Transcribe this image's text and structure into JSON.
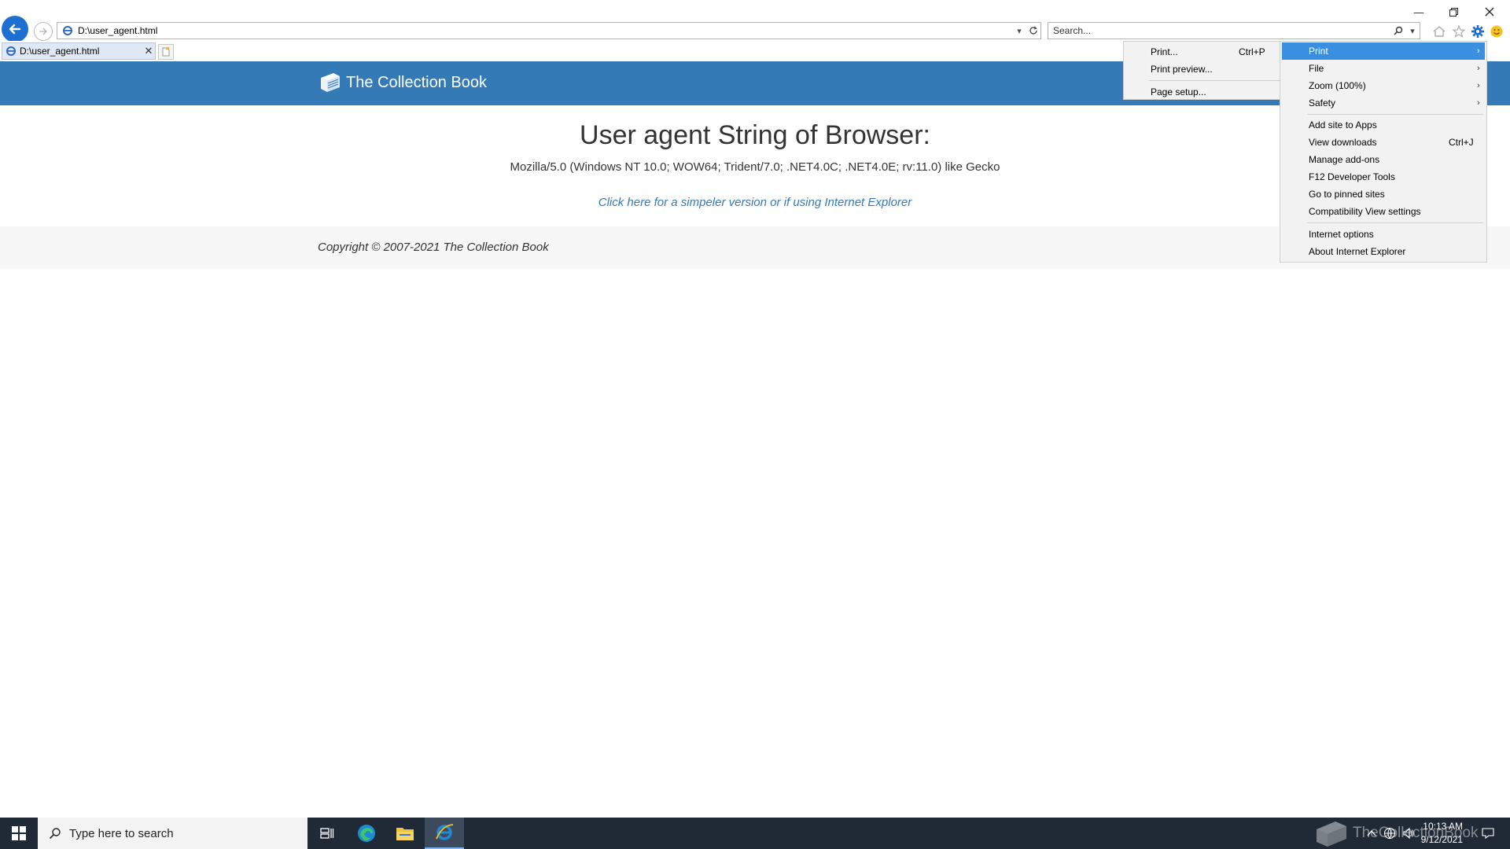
{
  "browser": {
    "address": "D:\\user_agent.html",
    "search_placeholder": "Search...",
    "tab_title": "D:\\user_agent.html"
  },
  "page": {
    "brand": "The Collection Book",
    "title": "User agent String of Browser:",
    "user_agent": "Mozilla/5.0 (Windows NT 10.0; WOW64; Trident/7.0; .NET4.0C; .NET4.0E; rv:11.0) like Gecko",
    "simpler_link": "Click here for a simpeler version or if using Internet Explorer",
    "copyright": "Copyright © 2007-2021 The Collection Book"
  },
  "print_submenu": {
    "items": [
      {
        "label": "Print...",
        "shortcut": "Ctrl+P"
      },
      {
        "label": "Print preview...",
        "shortcut": ""
      },
      {
        "label": "Page setup...",
        "shortcut": ""
      }
    ]
  },
  "tools_menu": {
    "items": [
      {
        "label": "Print",
        "shortcut": "",
        "submenu": true,
        "highlighted": true
      },
      {
        "label": "File",
        "shortcut": "",
        "submenu": true
      },
      {
        "label": "Zoom (100%)",
        "shortcut": "",
        "submenu": true
      },
      {
        "label": "Safety",
        "shortcut": "",
        "submenu": true
      },
      {
        "label": "Add site to Apps",
        "shortcut": ""
      },
      {
        "label": "View downloads",
        "shortcut": "Ctrl+J"
      },
      {
        "label": "Manage add-ons",
        "shortcut": ""
      },
      {
        "label": "F12 Developer Tools",
        "shortcut": ""
      },
      {
        "label": "Go to pinned sites",
        "shortcut": ""
      },
      {
        "label": "Compatibility View settings",
        "shortcut": ""
      },
      {
        "label": "Internet options",
        "shortcut": ""
      },
      {
        "label": "About Internet Explorer",
        "shortcut": ""
      }
    ]
  },
  "taskbar": {
    "search_placeholder": "Type here to search",
    "time": "10:13 AM",
    "date": "9/12/2021",
    "watermark": "TheCollectionBook"
  },
  "colors": {
    "header": "#337ab7",
    "menu_highlight": "#3b8fe0",
    "taskbar": "#202a36"
  },
  "icons": {
    "back": "back-arrow-icon",
    "forward": "forward-arrow-icon",
    "home": "home-icon",
    "favorites": "star-icon",
    "tools": "gear-icon",
    "feedback": "smiley-icon"
  }
}
